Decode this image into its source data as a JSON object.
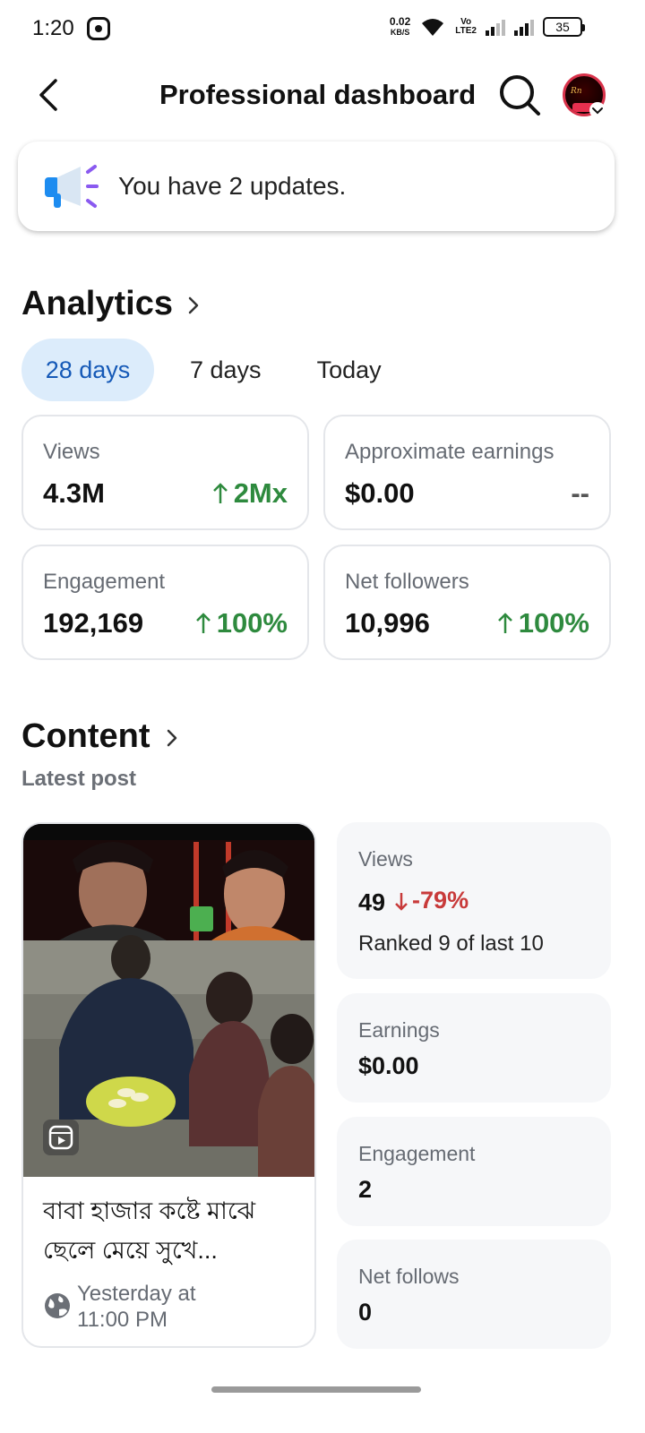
{
  "status_bar": {
    "time": "1:20",
    "net_speed_value": "0.02",
    "net_speed_unit": "KB/S",
    "volte_top": "Vo",
    "volte_bottom": "LTE2",
    "battery": "35"
  },
  "header": {
    "title": "Professional dashboard"
  },
  "updates": {
    "text": "You have 2 updates."
  },
  "analytics": {
    "title": "Analytics",
    "tabs": [
      {
        "label": "28 days",
        "active": true
      },
      {
        "label": "7 days",
        "active": false
      },
      {
        "label": "Today",
        "active": false
      }
    ],
    "metrics": [
      {
        "label": "Views",
        "value": "4.3M",
        "change": "2Mx",
        "trend": "up"
      },
      {
        "label": "Approximate earnings",
        "value": "$0.00",
        "change": "--",
        "trend": "none"
      },
      {
        "label": "Engagement",
        "value": "192,169",
        "change": "100%",
        "trend": "up"
      },
      {
        "label": "Net followers",
        "value": "10,996",
        "change": "100%",
        "trend": "up"
      }
    ]
  },
  "content": {
    "title": "Content",
    "subtitle": "Latest post",
    "post": {
      "caption": "বাবা হাজার কষ্টে মাঝে ছেলে মেয়ে সুখে...",
      "time_line1": "Yesterday at",
      "time_line2": "11:00 PM"
    },
    "stats": {
      "views_label": "Views",
      "views_value": "49",
      "views_change": "-79%",
      "views_rank": "Ranked 9 of last 10",
      "earnings_label": "Earnings",
      "earnings_value": "$0.00",
      "engagement_label": "Engagement",
      "engagement_value": "2",
      "net_follows_label": "Net follows",
      "net_follows_value": "0"
    }
  },
  "colors": {
    "positive": "#2e8a3e",
    "negative": "#c83a3a",
    "active_tab_bg": "#dcecfb",
    "active_tab_text": "#1559b7"
  }
}
